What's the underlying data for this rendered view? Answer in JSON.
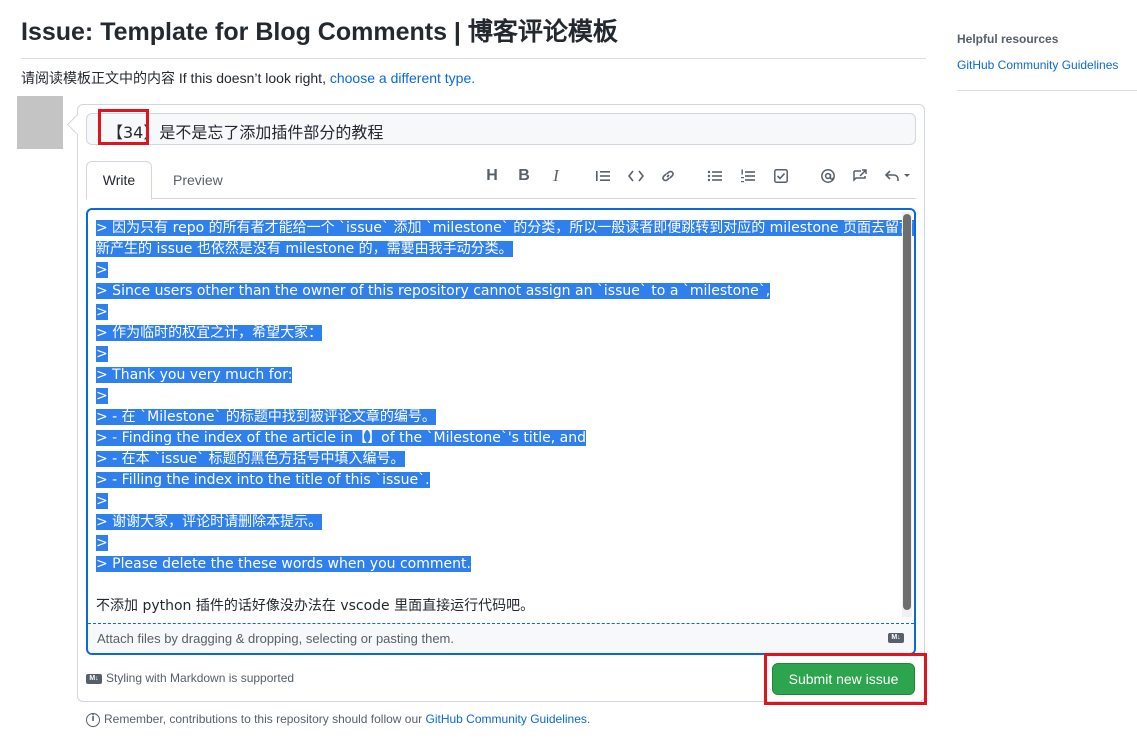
{
  "page": {
    "title": "Issue: Template for Blog Comments | 博客评论模板",
    "instruction_prefix": "请阅读模板正文中的内容 If this doesn’t look right, ",
    "instruction_link": "choose a different type."
  },
  "sidebar": {
    "heading": "Helpful resources",
    "link": "GitHub Community Guidelines"
  },
  "issue_title": {
    "value": "【34】是不是忘了添加插件部分的教程"
  },
  "tabs": {
    "write": "Write",
    "preview": "Preview"
  },
  "toolbar": {
    "icons": [
      "heading-icon",
      "bold-icon",
      "italic-icon",
      "quote-icon",
      "code-icon",
      "link-icon",
      "unordered-list-icon",
      "ordered-list-icon",
      "task-list-icon",
      "mention-icon",
      "cross-reference-icon",
      "reply-icon"
    ]
  },
  "editor": {
    "lines": [
      "> 因为只有 repo 的所有者才能给一个 `issue` 添加 `milestone` 的分类，所以一般读者即便跳转到对应的 milestone 页面去留言，",
      "新产生的 issue 也依然是没有 milestone 的，需要由我手动分类。",
      ">",
      "> Since users other than the owner of this repository cannot assign an `issue` to a `milestone`,",
      ">",
      "> 作为临时的权宜之计，希望大家：",
      ">",
      "> Thank you very much for:",
      ">",
      "> - 在 `Milestone` 的标题中找到被评论文章的编号。",
      "> - Finding the index of the article in【】of the `Milestone`'s title, and",
      "> - 在本 `issue` 标题的黑色方括号中填入编号。",
      "> - Filling the index into the title of this `issue`.",
      ">",
      "> 谢谢大家，评论时请删除本提示。",
      ">",
      "> Please delete the these words when you comment.",
      "",
      "不添加 python 插件的话好像没办法在 vscode 里面直接运行代码吧。"
    ],
    "attach_hint": "Attach files by dragging & dropping, selecting or pasting them."
  },
  "footer": {
    "markdown_note": "Styling with Markdown is supported",
    "submit_label": "Submit new issue",
    "remember_prefix": "Remember, contributions to this repository should follow our ",
    "remember_link": "GitHub Community Guidelines",
    "remember_suffix": "."
  },
  "colors": {
    "accent": "#0969da",
    "submit": "#2da44e",
    "selection": "#2f80ed",
    "highlight_box": "#e0141e"
  }
}
